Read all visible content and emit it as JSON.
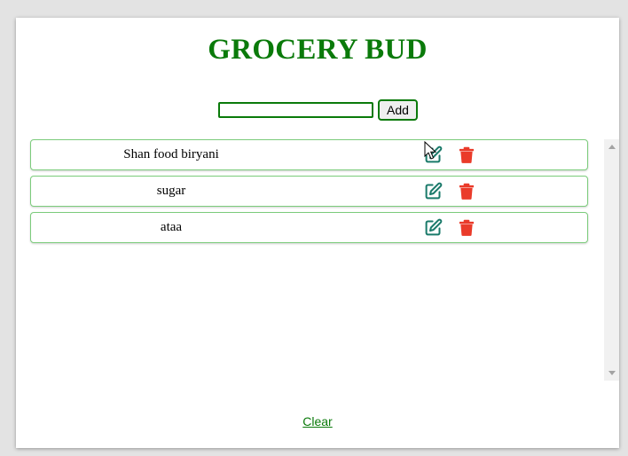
{
  "app": {
    "title": "GROCERY BUD"
  },
  "form": {
    "input_value": "",
    "input_placeholder": "",
    "add_label": "Add"
  },
  "items": [
    {
      "label": "Shan food biryani",
      "edit_icon": "edit-icon",
      "delete_icon": "trash-icon"
    },
    {
      "label": "sugar",
      "edit_icon": "edit-icon",
      "delete_icon": "trash-icon"
    },
    {
      "label": "ataa",
      "edit_icon": "edit-icon",
      "delete_icon": "trash-icon"
    }
  ],
  "footer": {
    "clear_label": "Clear"
  },
  "colors": {
    "brand_green": "#0a7a0a",
    "edit_teal": "#1a7a6a",
    "delete_red": "#ea3b2a",
    "item_border": "#7ccc7c"
  }
}
